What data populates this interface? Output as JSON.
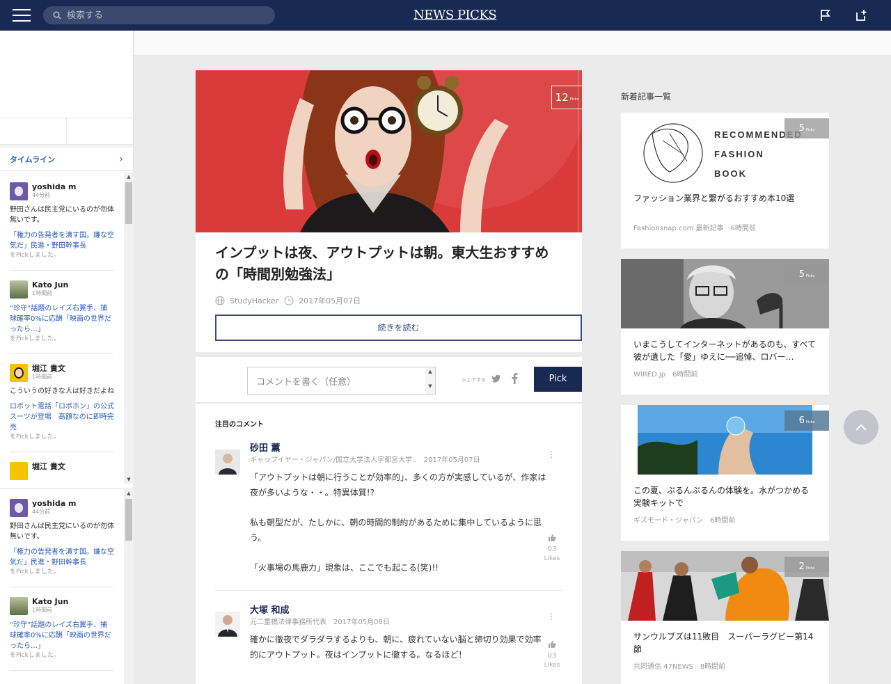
{
  "header": {
    "search_placeholder": "検索する",
    "logo": "NEWS PICKS"
  },
  "sidebar": {
    "timeline_label": "タイムライン",
    "items": [
      {
        "name": "yoshida m",
        "time": "44分前",
        "comment": "野田さんは民主党にいるのが勿体無いです。",
        "article": "「権力の告発者を潰す国。嫌な空気だ」民進・野田幹事長",
        "picked": "をPickしました。",
        "avatar_color": "#8a4aa8"
      },
      {
        "name": "Kato Jun",
        "time": "1時間前",
        "comment": "",
        "article": "“珍守”話題のレイズ右翼手、捕球確率0%に応酬「映画の世界だったら…」",
        "picked": "をPickしました。",
        "avatar_color": "#6b7b4a"
      },
      {
        "name": "堀江 貴文",
        "time": "1時間前",
        "comment": "こういうの好きな人は好きだよね",
        "article": "ロボット電話「ロボホン」の公式スーツが登場　高額なのに即時完売",
        "picked": "をPickしました。",
        "avatar_color": "#e6b800"
      },
      {
        "name": "堀江 貴文",
        "time": "",
        "comment": "",
        "article": "",
        "picked": "",
        "avatar_color": "#e6b800"
      }
    ],
    "items2": [
      {
        "name": "yoshida m",
        "time": "44分前",
        "comment": "野田さんは民主党にいるのが勿体無いです。",
        "article": "「権力の告発者を潰す国。嫌な空気だ」民進・野田幹事長",
        "picked": "をPickしました。",
        "avatar_color": "#8a4aa8"
      },
      {
        "name": "Kato Jun",
        "time": "1時間前",
        "comment": "",
        "article": "“珍守”話題のレイズ右翼手、捕球確率0%に応酬「映画の世界だったら…」",
        "picked": "をPickしました。",
        "avatar_color": "#6b7b4a"
      }
    ]
  },
  "article": {
    "picks_count": "12",
    "picks_unit": "Picks",
    "title": "インプットは夜、アウトプットは朝。東大生おすすめの「時間別勉強法」",
    "source": "StudyHacker",
    "date": "2017年05月07日",
    "read_more": "続きを読む"
  },
  "comment_bar": {
    "placeholder": "コメントを書く（任意）",
    "share_label": "シェアする",
    "pick_button": "Pick"
  },
  "comments": {
    "title": "注目のコメント",
    "items": [
      {
        "name": "砂田 薫",
        "affiliation": "ギャップイヤー・ジャパン/国立大学法人宇都宮大学‥",
        "date": "2017年05月07日",
        "paragraphs": [
          "「アウトプットは朝に行うことが効率的」、多くの方が実感しているが、作家は夜が多いような・・。特異体質!?",
          "私も朝型だが、たしかに、朝の時間的制約があるために集中しているように思う。",
          "「火事場の馬鹿力」現象は、ここでも起こる(笑)!!"
        ],
        "likes": "03",
        "likes_label": "Likes"
      },
      {
        "name": "大塚 和成",
        "affiliation": "元二重橋法律事務所代表",
        "date": "2017年05月08日",
        "paragraphs": [
          "確かに徹夜でダラダラするよりも、朝に、疲れていない脳と締切り効果で効率的にアウトプット。夜はインプットに徹する。なるほど！"
        ],
        "likes": "03",
        "likes_label": "Likes"
      }
    ]
  },
  "right": {
    "title": "新着記事一覧",
    "cards": [
      {
        "picks": "5",
        "title": "ファッション業界と繋がるおすすめ本10選",
        "source": "Fashionsnap.com 最新記事　6時間前",
        "img_text": [
          "RECOMMENDED",
          "FASHION",
          "BOOK"
        ]
      },
      {
        "picks": "5",
        "title": "いまこうしてインターネットがあるのも、すべて彼が遺した「愛」ゆえに──追悼、ロバー…",
        "source": "WIRED.jp　6時間前"
      },
      {
        "picks": "6",
        "title": "この夏、ぷるんぷるんの体験を。水がつかめる実験キットで",
        "source": "ギズモード・ジャパン　6時間前"
      },
      {
        "picks": "2",
        "title": "サンウルブズは11敗目　スーパーラグビー第14節",
        "source": "共同通信 47NEWS　8時間前"
      }
    ],
    "picks_unit": "Picks"
  },
  "colors": {
    "header_bg": "#192a52",
    "link_blue": "#2a5bb5",
    "pick_button": "#192a52"
  }
}
